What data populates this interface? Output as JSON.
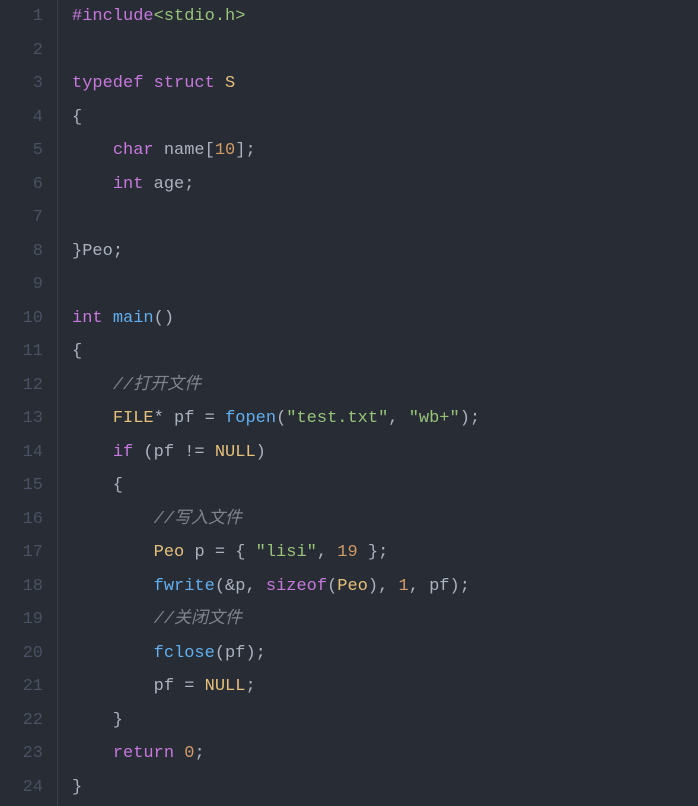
{
  "lines": [
    {
      "num": 1,
      "tokens": [
        {
          "t": "#include",
          "c": "kw-pp"
        },
        {
          "t": "<stdio.h>",
          "c": "hdr"
        }
      ]
    },
    {
      "num": 2,
      "tokens": []
    },
    {
      "num": 3,
      "tokens": [
        {
          "t": "typedef",
          "c": "kw"
        },
        {
          "t": " ",
          "c": ""
        },
        {
          "t": "struct",
          "c": "kw"
        },
        {
          "t": " ",
          "c": ""
        },
        {
          "t": "S",
          "c": "type"
        }
      ]
    },
    {
      "num": 4,
      "tokens": [
        {
          "t": "{",
          "c": "punct"
        }
      ]
    },
    {
      "num": 5,
      "tokens": [
        {
          "t": "    ",
          "c": ""
        },
        {
          "t": "char",
          "c": "kw"
        },
        {
          "t": " ",
          "c": ""
        },
        {
          "t": "name",
          "c": "ident"
        },
        {
          "t": "[",
          "c": "punct"
        },
        {
          "t": "10",
          "c": "num"
        },
        {
          "t": "];",
          "c": "punct"
        }
      ]
    },
    {
      "num": 6,
      "tokens": [
        {
          "t": "    ",
          "c": ""
        },
        {
          "t": "int",
          "c": "kw"
        },
        {
          "t": " ",
          "c": ""
        },
        {
          "t": "age",
          "c": "ident"
        },
        {
          "t": ";",
          "c": "punct"
        }
      ]
    },
    {
      "num": 7,
      "tokens": []
    },
    {
      "num": 8,
      "tokens": [
        {
          "t": "}",
          "c": "punct"
        },
        {
          "t": "Peo",
          "c": "ident"
        },
        {
          "t": ";",
          "c": "punct"
        }
      ]
    },
    {
      "num": 9,
      "tokens": []
    },
    {
      "num": 10,
      "tokens": [
        {
          "t": "int",
          "c": "kw"
        },
        {
          "t": " ",
          "c": ""
        },
        {
          "t": "main",
          "c": "fn-main"
        },
        {
          "t": "()",
          "c": "punct"
        }
      ]
    },
    {
      "num": 11,
      "tokens": [
        {
          "t": "{",
          "c": "punct"
        }
      ]
    },
    {
      "num": 12,
      "tokens": [
        {
          "t": "    ",
          "c": ""
        },
        {
          "t": "//打开文件",
          "c": "comment"
        }
      ]
    },
    {
      "num": 13,
      "tokens": [
        {
          "t": "    ",
          "c": ""
        },
        {
          "t": "FILE",
          "c": "type"
        },
        {
          "t": "* ",
          "c": "punct"
        },
        {
          "t": "pf",
          "c": "ident"
        },
        {
          "t": " = ",
          "c": "op"
        },
        {
          "t": "fopen",
          "c": "fn"
        },
        {
          "t": "(",
          "c": "punct"
        },
        {
          "t": "\"test.txt\"",
          "c": "str"
        },
        {
          "t": ", ",
          "c": "punct"
        },
        {
          "t": "\"wb+\"",
          "c": "str"
        },
        {
          "t": ");",
          "c": "punct"
        }
      ]
    },
    {
      "num": 14,
      "tokens": [
        {
          "t": "    ",
          "c": ""
        },
        {
          "t": "if",
          "c": "kw"
        },
        {
          "t": " (",
          "c": "punct"
        },
        {
          "t": "pf",
          "c": "ident"
        },
        {
          "t": " != ",
          "c": "op"
        },
        {
          "t": "NULL",
          "c": "type"
        },
        {
          "t": ")",
          "c": "punct"
        }
      ]
    },
    {
      "num": 15,
      "tokens": [
        {
          "t": "    {",
          "c": "punct"
        }
      ]
    },
    {
      "num": 16,
      "tokens": [
        {
          "t": "        ",
          "c": ""
        },
        {
          "t": "//写入文件",
          "c": "comment"
        }
      ]
    },
    {
      "num": 17,
      "tokens": [
        {
          "t": "        ",
          "c": ""
        },
        {
          "t": "Peo",
          "c": "type"
        },
        {
          "t": " ",
          "c": ""
        },
        {
          "t": "p",
          "c": "ident"
        },
        {
          "t": " = { ",
          "c": "op"
        },
        {
          "t": "\"lisi\"",
          "c": "str"
        },
        {
          "t": ", ",
          "c": "punct"
        },
        {
          "t": "19",
          "c": "num"
        },
        {
          "t": " };",
          "c": "punct"
        }
      ]
    },
    {
      "num": 18,
      "tokens": [
        {
          "t": "        ",
          "c": ""
        },
        {
          "t": "fwrite",
          "c": "fn"
        },
        {
          "t": "(&",
          "c": "punct"
        },
        {
          "t": "p",
          "c": "ident"
        },
        {
          "t": ", ",
          "c": "punct"
        },
        {
          "t": "sizeof",
          "c": "kw"
        },
        {
          "t": "(",
          "c": "punct"
        },
        {
          "t": "Peo",
          "c": "type"
        },
        {
          "t": "), ",
          "c": "punct"
        },
        {
          "t": "1",
          "c": "num"
        },
        {
          "t": ", ",
          "c": "punct"
        },
        {
          "t": "pf",
          "c": "ident"
        },
        {
          "t": ");",
          "c": "punct"
        }
      ]
    },
    {
      "num": 19,
      "tokens": [
        {
          "t": "        ",
          "c": ""
        },
        {
          "t": "//关闭文件",
          "c": "comment"
        }
      ]
    },
    {
      "num": 20,
      "tokens": [
        {
          "t": "        ",
          "c": ""
        },
        {
          "t": "fclose",
          "c": "fn"
        },
        {
          "t": "(",
          "c": "punct"
        },
        {
          "t": "pf",
          "c": "ident"
        },
        {
          "t": ");",
          "c": "punct"
        }
      ]
    },
    {
      "num": 21,
      "tokens": [
        {
          "t": "        ",
          "c": ""
        },
        {
          "t": "pf",
          "c": "ident"
        },
        {
          "t": " = ",
          "c": "op"
        },
        {
          "t": "NULL",
          "c": "type"
        },
        {
          "t": ";",
          "c": "punct"
        }
      ]
    },
    {
      "num": 22,
      "tokens": [
        {
          "t": "    }",
          "c": "punct"
        }
      ]
    },
    {
      "num": 23,
      "tokens": [
        {
          "t": "    ",
          "c": ""
        },
        {
          "t": "return",
          "c": "kw"
        },
        {
          "t": " ",
          "c": ""
        },
        {
          "t": "0",
          "c": "num"
        },
        {
          "t": ";",
          "c": "punct"
        }
      ]
    },
    {
      "num": 24,
      "tokens": [
        {
          "t": "}",
          "c": "punct"
        }
      ]
    }
  ]
}
